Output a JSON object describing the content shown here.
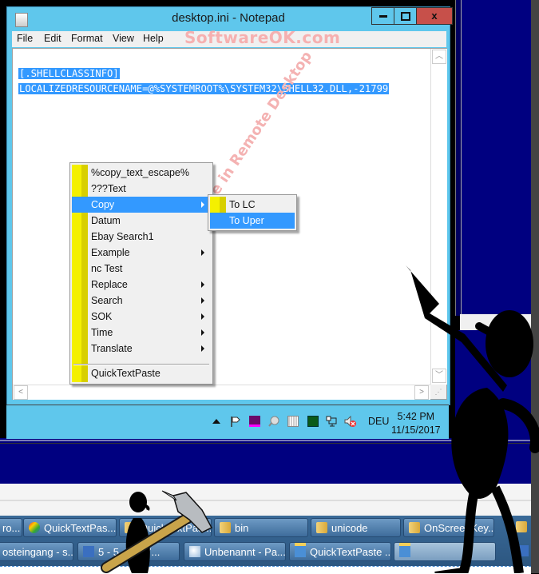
{
  "notepad": {
    "title": "desktop.ini - Notepad",
    "menu": [
      "File",
      "Edit",
      "Format",
      "View",
      "Help"
    ],
    "watermark": "SoftwareOK.com",
    "content_lines": [
      "[.SHELLCLASSINFO]",
      "LOCALIZEDRESOURCENAME=@%SYSTEMROOT%\\SYSTEM32\\SHELL32.DLL,-21799"
    ],
    "caption_buttons": {
      "minimize": "▬",
      "maximize": "□",
      "close": "x"
    }
  },
  "context_menu": {
    "items": [
      {
        "label": "%copy_text_escape%",
        "submenu": false,
        "selected": false
      },
      {
        "label": "???Text",
        "submenu": false,
        "selected": false
      },
      {
        "label": "Copy",
        "submenu": true,
        "selected": true
      },
      {
        "label": "Datum",
        "submenu": false,
        "selected": false
      },
      {
        "label": "Ebay Search1",
        "submenu": false,
        "selected": false
      },
      {
        "label": "Example",
        "submenu": true,
        "selected": false
      },
      {
        "label": "nc Test",
        "submenu": false,
        "selected": false
      },
      {
        "label": "Replace",
        "submenu": true,
        "selected": false
      },
      {
        "label": "Search",
        "submenu": true,
        "selected": false
      },
      {
        "label": "SOK",
        "submenu": true,
        "selected": false
      },
      {
        "label": "Time",
        "submenu": true,
        "selected": false
      },
      {
        "label": "Translate",
        "submenu": true,
        "selected": false
      }
    ],
    "footer": "QuickTextPaste",
    "submenu": {
      "items": [
        {
          "label": "To LC",
          "selected": false
        },
        {
          "label": "To Uper",
          "selected": true
        }
      ]
    }
  },
  "watermark_diagonal": "Uppercase in Remote Desktop",
  "tray": {
    "icons": [
      "show-hidden-icons",
      "action-center-flag-icon",
      "purple-app-icon",
      "magnifier-icon",
      "grid-app-icon",
      "green-app-icon",
      "network-icon",
      "volume-muted-icon"
    ],
    "language": "DEU",
    "time": "5:42 PM",
    "date": "11/15/2017"
  },
  "host_taskbar": {
    "row1": [
      {
        "label": "ro...",
        "icon": "window-icon"
      },
      {
        "label": "QuickTextPas...",
        "icon": "quicktextpaste-icon"
      },
      {
        "label": "QuickTextPas...",
        "icon": "folder-icon"
      },
      {
        "label": "bin",
        "icon": "folder-icon"
      },
      {
        "label": "unicode",
        "icon": "folder-icon"
      },
      {
        "label": "OnScreenKey...",
        "icon": "folder-icon"
      },
      {
        "label": "",
        "icon": "folder-icon"
      }
    ],
    "row2": [
      {
        "label": "osteingang - s...",
        "icon": "mail-icon"
      },
      {
        "label": "5 - 5 - 2017...",
        "icon": "remote-desktop-icon"
      },
      {
        "label": "Unbenannt - Pa...",
        "icon": "paint-icon"
      },
      {
        "label": "QuickTextPaste ...",
        "icon": "keyboard-icon"
      },
      {
        "label": "",
        "icon": "keyboard-icon"
      },
      {
        "label": "",
        "icon": "network-globe-icon"
      }
    ]
  },
  "colors": {
    "window_frame": "#5fc7ec",
    "selection": "#3399ff",
    "remote_bg": "#000080",
    "close_button": "#c7504a",
    "menu_stripe": "#f4f000"
  }
}
